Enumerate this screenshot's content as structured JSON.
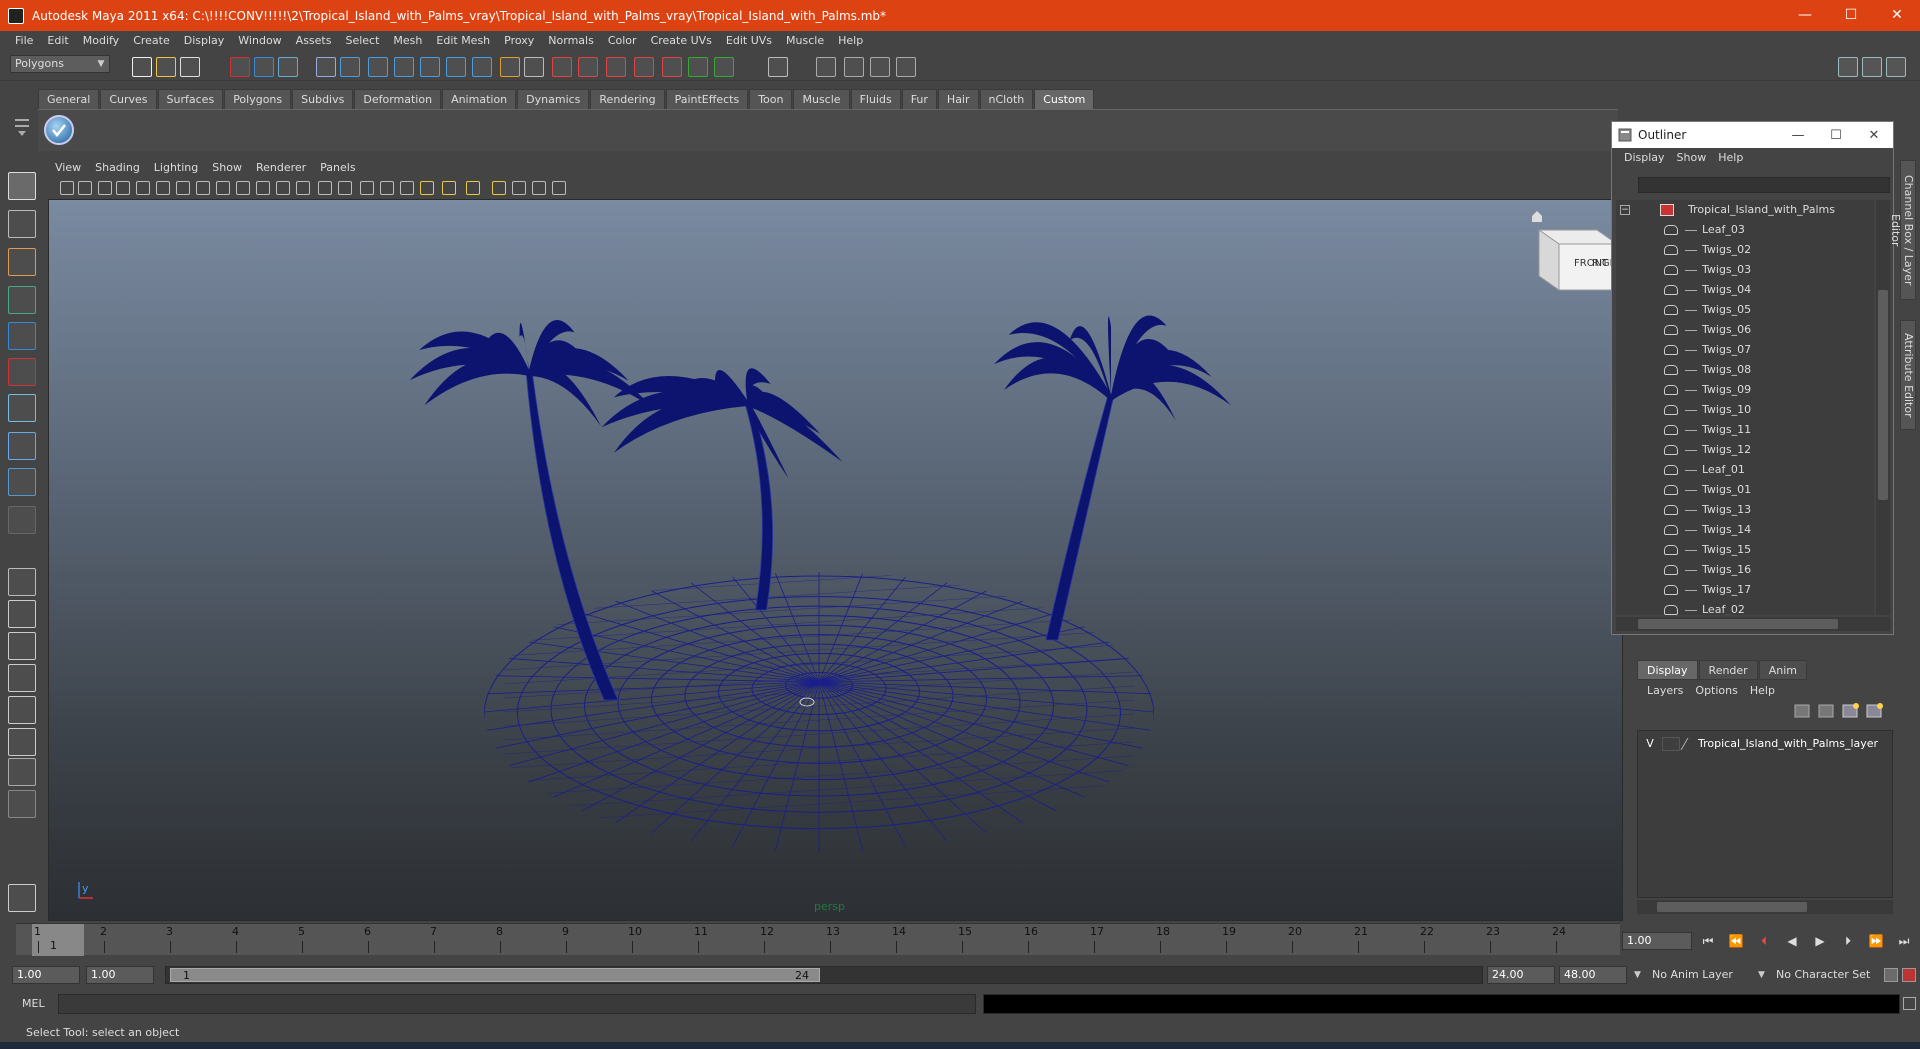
{
  "window": {
    "title": "Autodesk Maya 2011 x64: C:\\!!!!CONV!!!!!\\2\\Tropical_Island_with_Palms_vray\\Tropical_Island_with_Palms_vray\\Tropical_Island_with_Palms.mb*",
    "minimize": "—",
    "maximize": "☐",
    "close": "✕"
  },
  "menubar": [
    "File",
    "Edit",
    "Modify",
    "Create",
    "Display",
    "Window",
    "Assets",
    "Select",
    "Mesh",
    "Edit Mesh",
    "Proxy",
    "Normals",
    "Color",
    "Create UVs",
    "Edit UVs",
    "Muscle",
    "Help"
  ],
  "statusline": {
    "mode": "Polygons",
    "mode_arrow": "▼"
  },
  "shelf": {
    "tabs": [
      "General",
      "Curves",
      "Surfaces",
      "Polygons",
      "Subdivs",
      "Deformation",
      "Animation",
      "Dynamics",
      "Rendering",
      "PaintEffects",
      "Toon",
      "Muscle",
      "Fluids",
      "Fur",
      "Hair",
      "nCloth",
      "Custom"
    ],
    "active_tab": "Custom"
  },
  "viewport": {
    "menu": [
      "View",
      "Shading",
      "Lighting",
      "Show",
      "Renderer",
      "Panels"
    ],
    "camera": "persp",
    "viewcube_front": "FRONT",
    "viewcube_right": "RIGHT",
    "axis_y": "y",
    "wire_color": "#1a1f8a",
    "palm_color": "#0c1470"
  },
  "outliner": {
    "title": "Outliner",
    "menu": [
      "Display",
      "Show",
      "Help"
    ],
    "root": "Tropical_Island_with_Palms",
    "items": [
      "Leaf_03",
      "Twigs_02",
      "Twigs_03",
      "Twigs_04",
      "Twigs_05",
      "Twigs_06",
      "Twigs_07",
      "Twigs_08",
      "Twigs_09",
      "Twigs_10",
      "Twigs_11",
      "Twigs_12",
      "Leaf_01",
      "Twigs_01",
      "Twigs_13",
      "Twigs_14",
      "Twigs_15",
      "Twigs_16",
      "Twigs_17",
      "Leaf_02"
    ]
  },
  "layer_panel": {
    "tabs": [
      "Display",
      "Render",
      "Anim"
    ],
    "active_tab": "Display",
    "menu": [
      "Layers",
      "Options",
      "Help"
    ],
    "layer_visible": "V",
    "layer_name": "Tropical_Island_with_Palms_layer"
  },
  "side_tabs": [
    "Channel Box / Layer Editor",
    "Attribute Editor"
  ],
  "timeslider": {
    "frames": [
      "1",
      "2",
      "3",
      "4",
      "5",
      "6",
      "7",
      "8",
      "9",
      "10",
      "11",
      "12",
      "13",
      "14",
      "15",
      "16",
      "17",
      "18",
      "19",
      "20",
      "21",
      "22",
      "23",
      "24"
    ],
    "current_frame": "1",
    "current_time_field": "1.00"
  },
  "range": {
    "start": "1.00",
    "playback_start": "1.00",
    "handle_start": "1",
    "handle_end": "24",
    "playback_end": "24.00",
    "end": "48.00",
    "anim_layer": "No Anim Layer",
    "character_set": "No Character Set"
  },
  "cmdline": {
    "label": "MEL"
  },
  "helpline": {
    "text": "Select Tool: select an object"
  }
}
